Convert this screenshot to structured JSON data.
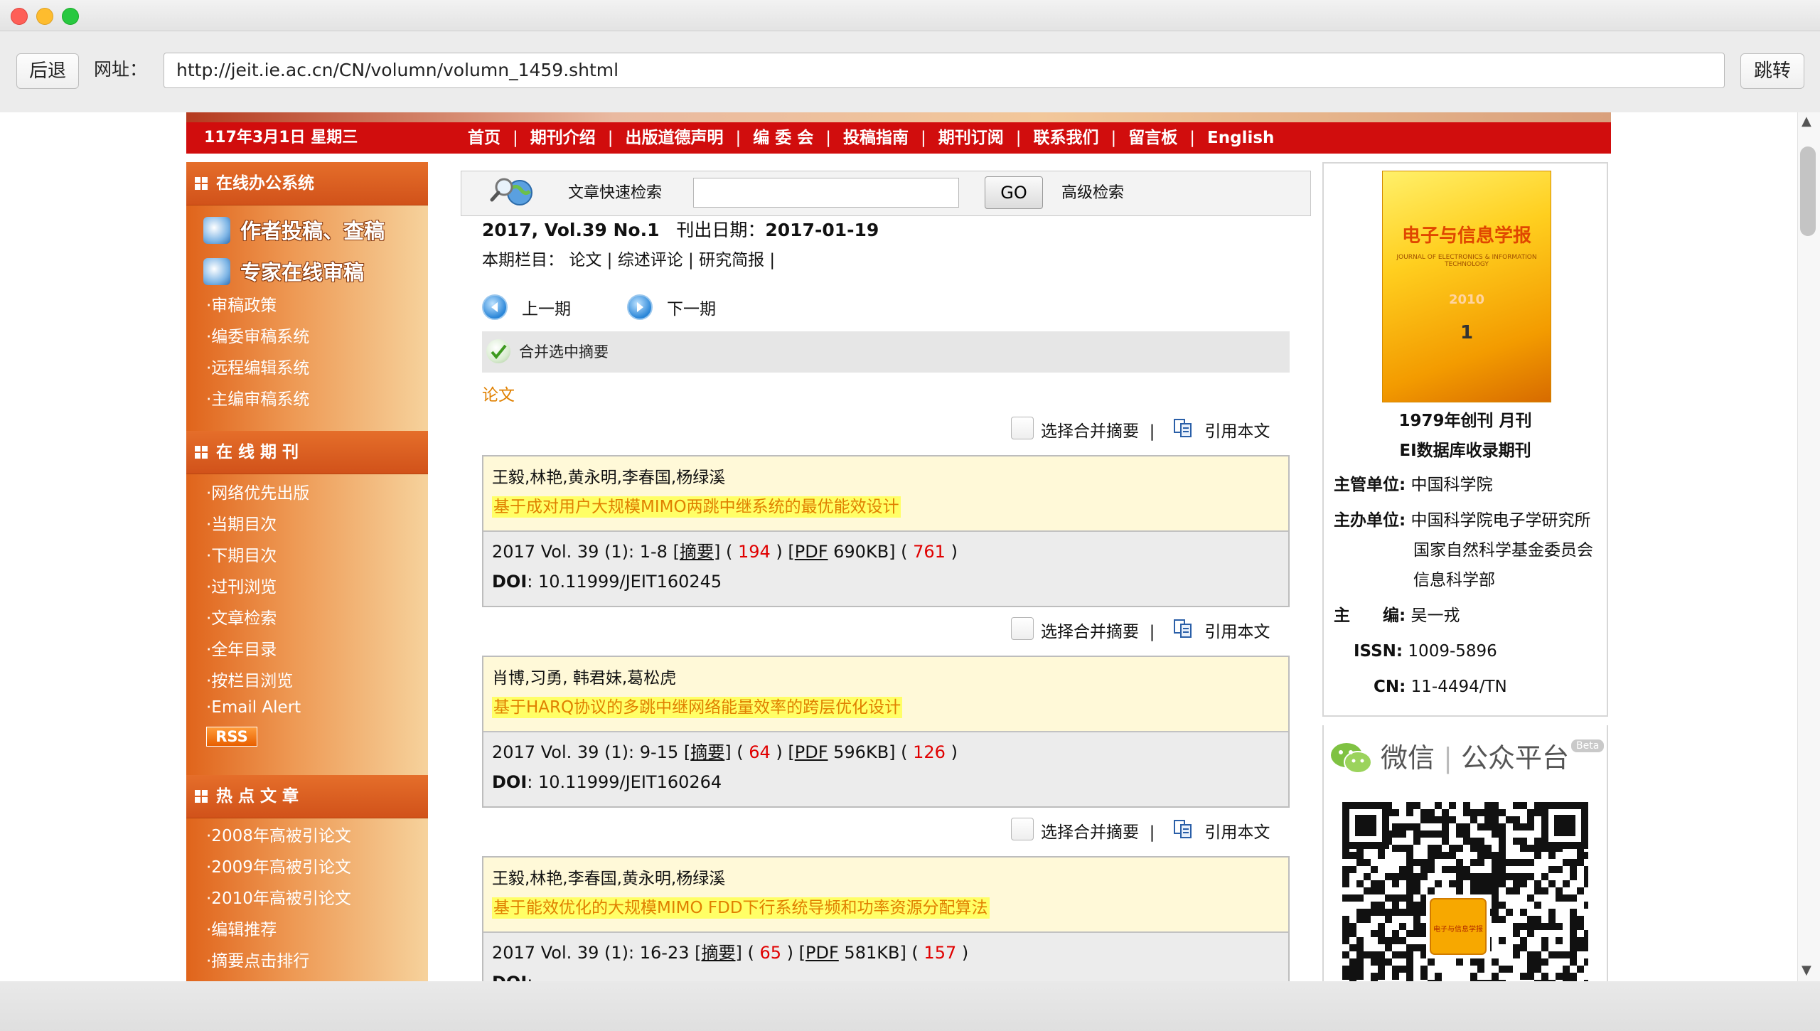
{
  "toolbar": {
    "back_label": "后退",
    "address_label": "网址：",
    "url": "http://jeit.ie.ac.cn/CN/volumn/volumn_1459.shtml",
    "go_label": "跳转"
  },
  "header": {
    "date": "117年3月1日 星期三",
    "nav": [
      "首页",
      "期刊介绍",
      "出版道德声明",
      "编 委 会",
      "投稿指南",
      "期刊订阅",
      "联系我们",
      "留言板",
      "English"
    ],
    "separator": "|"
  },
  "sidebar": {
    "office": {
      "title": "在线办公系统",
      "big_links": [
        "作者投稿、查稿",
        "专家在线审稿"
      ],
      "links": [
        "·审稿政策",
        "·编委审稿系统",
        "·远程编辑系统",
        "·主编审稿系统"
      ]
    },
    "online": {
      "title": "在 线 期 刊",
      "links": [
        "·网络优先出版",
        "·当期目次",
        "·下期目次",
        "·过刊浏览",
        "·文章检索",
        "·全年目录",
        "·按栏目浏览",
        "·Email Alert"
      ],
      "rss": "RSS"
    },
    "hot": {
      "title": "热 点 文 章",
      "links": [
        "·2008年高被引论文",
        "·2009年高被引论文",
        "·2010年高被引论文",
        "·编辑推荐",
        "·摘要点击排行"
      ]
    }
  },
  "search": {
    "label": "文章快速检索",
    "value": "",
    "go": "GO",
    "advanced": "高级检索"
  },
  "issue": {
    "title": "2017, Vol.39 No.1",
    "date_label": "刊出日期：",
    "date": "2017-01-19",
    "columns_label": "本期栏目：",
    "columns": [
      "论文",
      "综述评论",
      "研究简报"
    ],
    "prev": "上一期",
    "next": "下一期",
    "merge_label": "合并选中摘要",
    "section": "论文"
  },
  "article_actions": {
    "select_label": "选择合并摘要",
    "sep": "|",
    "cite_label": "引用本文"
  },
  "articles": [
    {
      "authors": "王毅,林艳,黄永明,李春国,杨绿溪",
      "title": "基于成对用户大规模MIMO两跳中继系统的最优能效设计",
      "citation": "2017 Vol. 39 (1): 1-8",
      "abstract_label": "摘要",
      "abstract_count": "194",
      "pdf_label": "PDF",
      "pdf_size": "690KB",
      "pdf_count": "761",
      "doi_label": "DOI",
      "doi": "10.11999/JEIT160245"
    },
    {
      "authors": "肖博,习勇, 韩君妹,葛松虎",
      "title": "基于HARQ协议的多跳中继网络能量效率的跨层优化设计",
      "citation": "2017 Vol. 39 (1): 9-15",
      "abstract_label": "摘要",
      "abstract_count": "64",
      "pdf_label": "PDF",
      "pdf_size": "596KB",
      "pdf_count": "126",
      "doi_label": "DOI",
      "doi": "10.11999/JEIT160264"
    },
    {
      "authors": "王毅,林艳,李春国,黄永明,杨绿溪",
      "title": "基于能效优化的大规模MIMO FDD下行系统导频和功率资源分配算法",
      "citation": "2017 Vol. 39 (1): 16-23",
      "abstract_label": "摘要",
      "abstract_count": "65",
      "pdf_label": "PDF",
      "pdf_size": "581KB",
      "pdf_count": "157",
      "doi_label": "DOI",
      "doi": ""
    }
  ],
  "journal": {
    "cover_title": "电子与信息学报",
    "cover_subtitle": "JOURNAL OF ELECTRONICS & INFORMATION TECHNOLOGY",
    "cover_year": "2010",
    "cover_number": "1",
    "founded": "1979年创刊 月刊",
    "ei": "EI数据库收录期刊",
    "supervisor_label": "主管单位:",
    "supervisor": "中国科学院",
    "sponsor_label": "主办单位:",
    "sponsors": [
      "中国科学院电子学研究所",
      "国家自然科学基金委员会",
      "信息科学部"
    ],
    "editor_label": "主　　编:",
    "editor": "吴一戎",
    "issn_label": "ISSN:",
    "issn": "1009-5896",
    "cn_label": "CN:",
    "cn": "11-4494/TN"
  },
  "wechat": {
    "text_a": "微信",
    "text_b": "公众平台",
    "beta": "Beta",
    "qr_center": "电子与信息学报"
  }
}
